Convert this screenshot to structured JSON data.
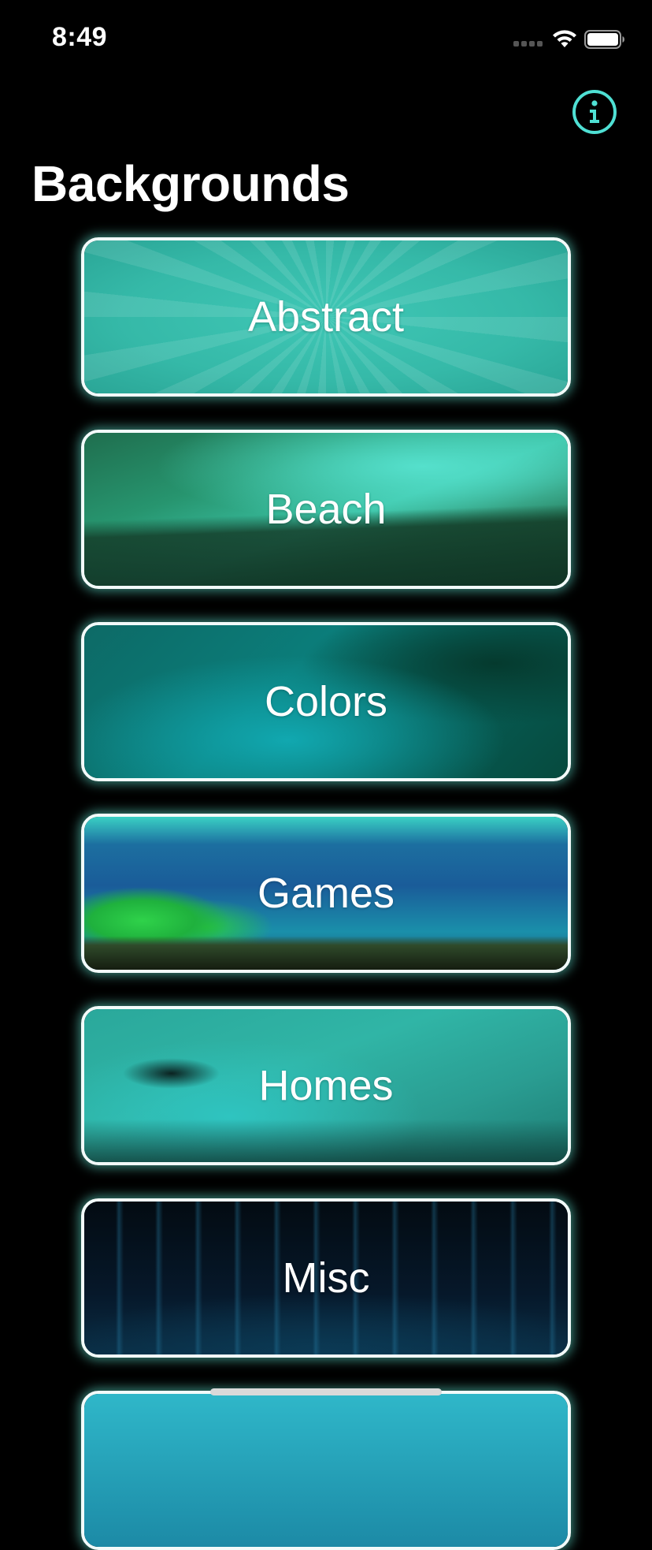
{
  "status_bar": {
    "time": "8:49"
  },
  "header": {
    "title": "Backgrounds",
    "info_icon": "info-circle-icon",
    "accent_color": "#4fe0d4"
  },
  "categories": [
    {
      "label": "Abstract"
    },
    {
      "label": "Beach"
    },
    {
      "label": "Colors"
    },
    {
      "label": "Games"
    },
    {
      "label": "Homes"
    },
    {
      "label": "Misc"
    },
    {
      "label": ""
    }
  ]
}
